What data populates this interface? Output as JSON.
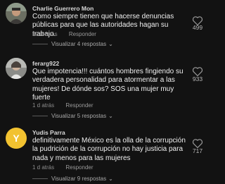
{
  "comments": [
    {
      "username": "Charlie Guerrero Mon",
      "text": "Como siempre tienen que hacerse denuncias públicas para que las autoridades hagan su trabajo.",
      "time": "20 h atrás",
      "reply_label": "Responder",
      "likes": "499",
      "view_replies": "Visualizar 4 respostas"
    },
    {
      "username": "ferarg922",
      "text": "Que impotencia!!! cuántos hombres fingiendo su verdadera personalidad para atormentar a las mujeres! De dónde sos? SOS una mujer muy fuerte",
      "time": "1 d atrás",
      "reply_label": "Responder",
      "likes": "933",
      "view_replies": "Visualizar 5 respostas"
    },
    {
      "username": "Yudis Parra",
      "avatar_letter": "Y",
      "text": "definitivamente México es la olla de la corrupción la pudrición de la corrupción no hay justicia para nada y menos para las mujeres",
      "time": "1 d atrás",
      "reply_label": "Responder",
      "likes": "717",
      "view_replies": "Visualizar 9 respostas"
    }
  ],
  "colors": {
    "background": "#121212",
    "yellow_avatar": "#f2c230",
    "muted_text": "#8d8d8d"
  },
  "icons": {
    "like": "heart-outline-icon",
    "expand": "chevron-down-icon"
  }
}
